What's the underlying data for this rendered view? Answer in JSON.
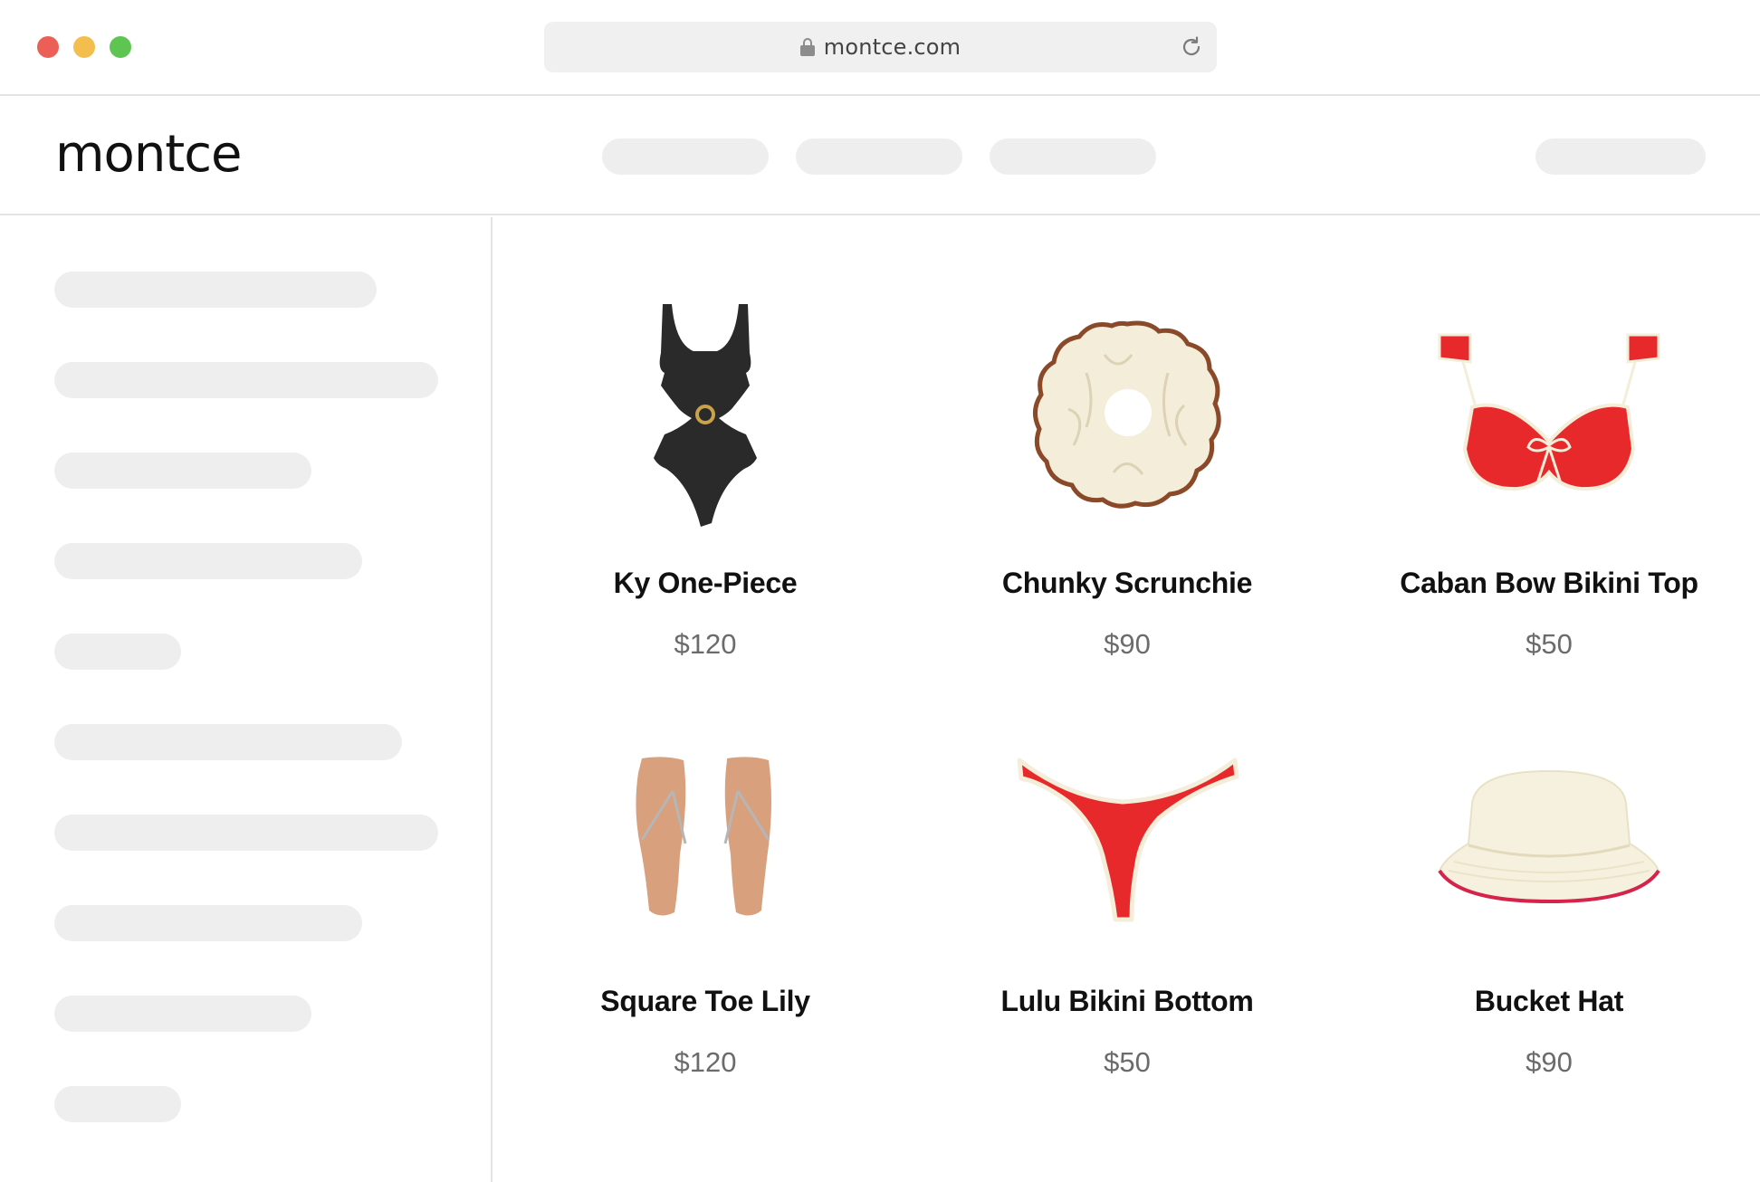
{
  "browser": {
    "url": "montce.com",
    "icons": [
      "close-dot",
      "minimize-dot",
      "maximize-dot",
      "lock-icon",
      "reload-icon"
    ]
  },
  "site": {
    "logo": "montce"
  },
  "products": [
    {
      "name": "Ky One-Piece",
      "price": "$120",
      "image": "black-one-piece-swimsuit",
      "colors": [
        "#2a2a2a",
        "#c9a24a"
      ]
    },
    {
      "name": "Chunky Scrunchie",
      "price": "$90",
      "image": "cream-scrunchie",
      "colors": [
        "#f3edd9",
        "#8a4a2a"
      ]
    },
    {
      "name": "Caban Bow Bikini Top",
      "price": "$50",
      "image": "red-bandeau-bikini-top",
      "colors": [
        "#e8292b",
        "#f3edd9"
      ]
    },
    {
      "name": "Square Toe Lily",
      "price": "$120",
      "image": "tan-flip-flops",
      "colors": [
        "#d9a07d",
        "#b6b6b6"
      ]
    },
    {
      "name": "Lulu Bikini Bottom",
      "price": "$50",
      "image": "red-bikini-bottom",
      "colors": [
        "#e8292b",
        "#f3edd9"
      ]
    },
    {
      "name": "Bucket Hat",
      "price": "$90",
      "image": "cream-bucket-hat",
      "colors": [
        "#f6f1df",
        "#d6234a"
      ]
    }
  ]
}
